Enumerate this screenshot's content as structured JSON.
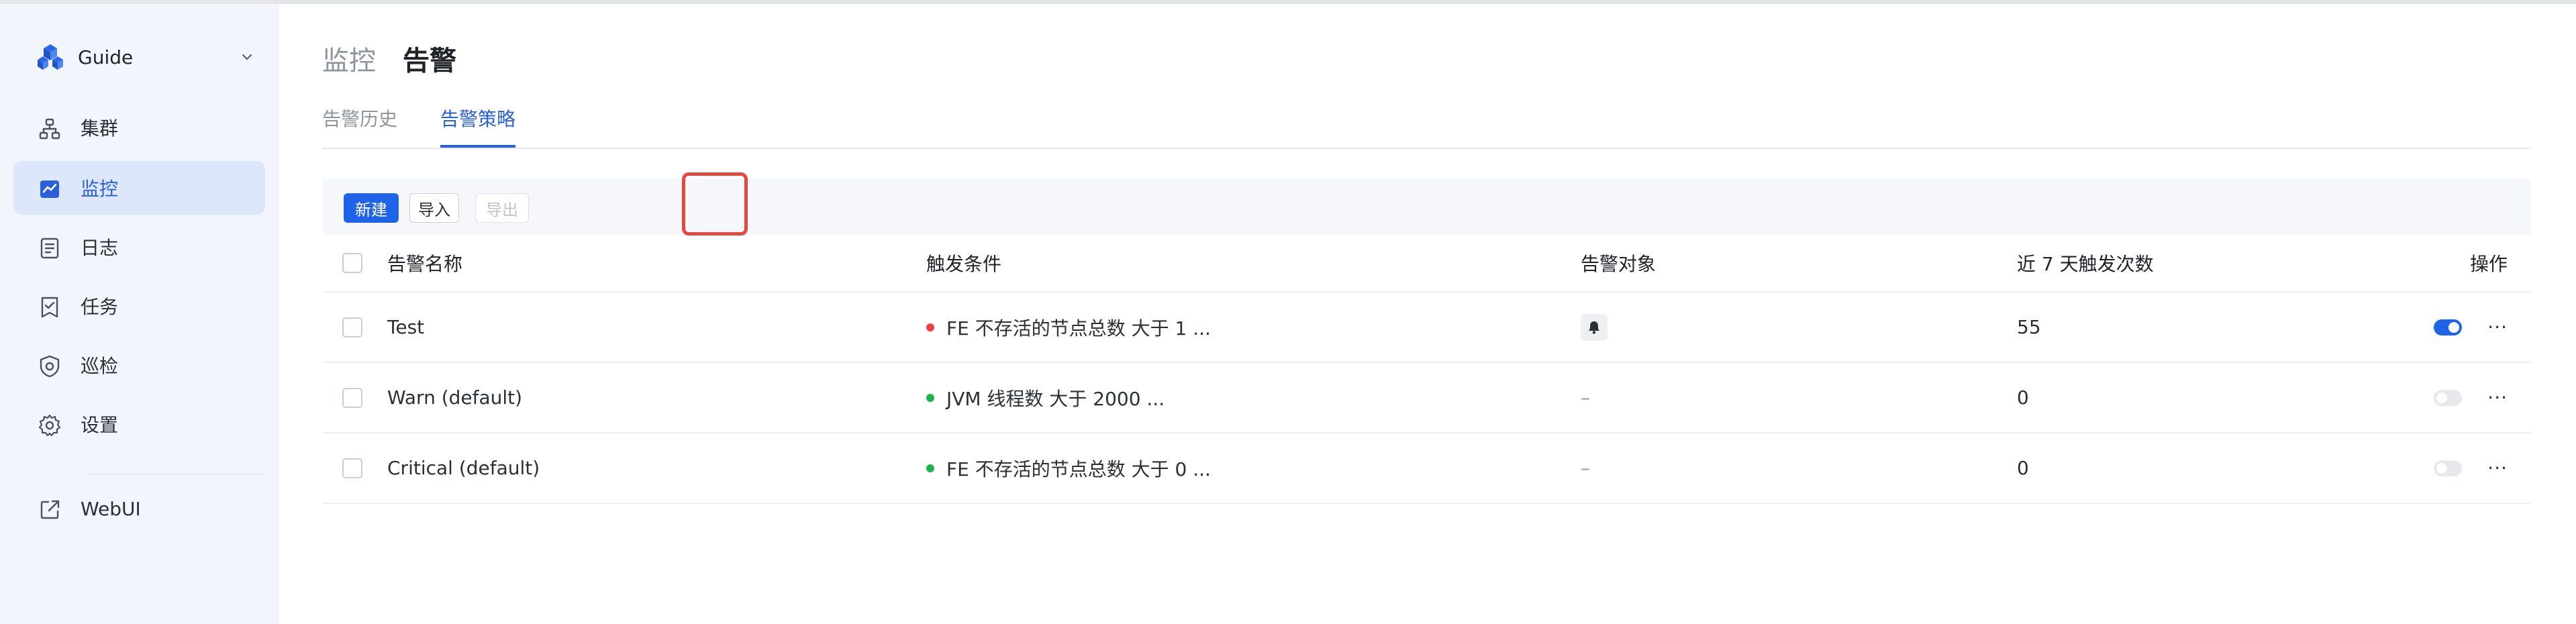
{
  "sidebar": {
    "brand": "Guide",
    "items": [
      {
        "label": "集群",
        "icon": "cluster-icon"
      },
      {
        "label": "监控",
        "icon": "chart-icon",
        "active": true
      },
      {
        "label": "日志",
        "icon": "log-icon"
      },
      {
        "label": "任务",
        "icon": "task-icon"
      },
      {
        "label": "巡检",
        "icon": "shield-icon"
      },
      {
        "label": "设置",
        "icon": "gear-icon"
      },
      {
        "label": "WebUI",
        "icon": "external-link-icon"
      }
    ]
  },
  "breadcrumb": {
    "parent": "监控",
    "current": "告警"
  },
  "tabs": [
    {
      "label": "告警历史"
    },
    {
      "label": "告警策略",
      "active": true
    }
  ],
  "toolbar": {
    "new_label": "新建",
    "import_label": "导入",
    "export_label": "导出"
  },
  "table": {
    "columns": [
      "告警名称",
      "触发条件",
      "告警对象",
      "近 7 天触发次数",
      "操作"
    ],
    "rows": [
      {
        "name": "Test",
        "condition": "FE 不存活的节点总数 大于 1 ...",
        "status_color": "#f04141",
        "target": "bell",
        "count": "55",
        "enabled": true
      },
      {
        "name": "Warn (default)",
        "condition": "JVM 线程数 大于 2000 ...",
        "status_color": "#1cb34d",
        "target": "–",
        "count": "0",
        "enabled": false
      },
      {
        "name": "Critical (default)",
        "condition": "FE 不存活的节点总数 大于 0 ...",
        "status_color": "#1cb34d",
        "target": "–",
        "count": "0",
        "enabled": false
      }
    ],
    "more_label": "···"
  },
  "colors": {
    "accent": "#1f64e8",
    "highlight": "#e64840",
    "status_red": "#f04141",
    "status_green": "#1cb34d"
  }
}
